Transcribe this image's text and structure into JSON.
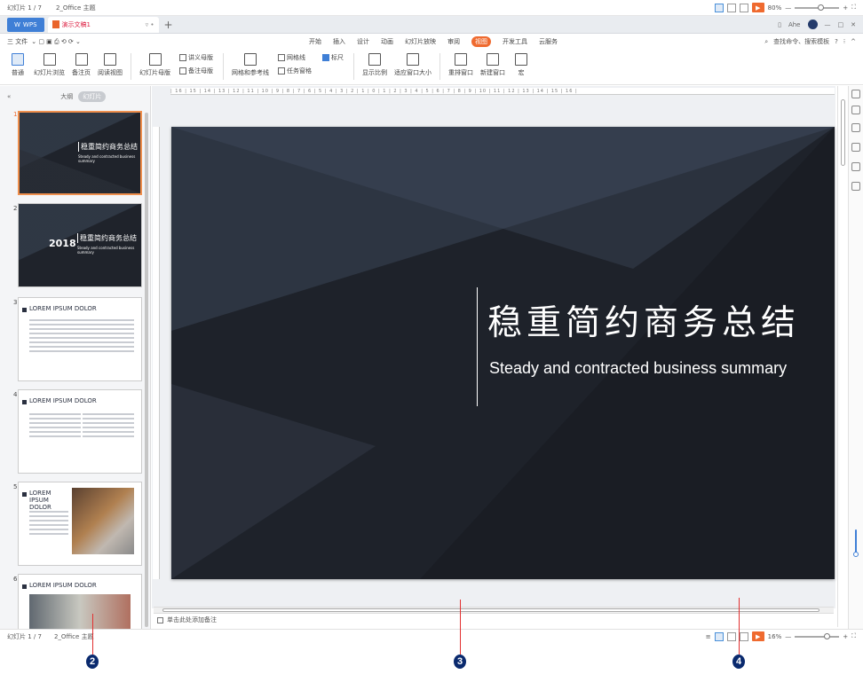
{
  "topbar": {
    "slide_counter": "幻灯片 1 / 7",
    "theme": "2_Office 主题",
    "zoom": "80%",
    "minus": "—",
    "plus": "+"
  },
  "tabs": {
    "wps_label": "WPS",
    "doc_label": "演示文稿1",
    "new_tab": "+",
    "signin": "Ahe",
    "minimize": "—",
    "restore": "□",
    "close": "✕"
  },
  "menu": {
    "file": "三 文件",
    "items": [
      "开始",
      "插入",
      "设计",
      "动画",
      "幻灯片放映",
      "审阅",
      "视图",
      "开发工具",
      "云服务"
    ],
    "active_index": 6,
    "search": "查找命令、搜索模板",
    "help": "?",
    "more": "⁝",
    "collapse": "^"
  },
  "ribbon": {
    "normal": "普通",
    "sorter": "幻灯片浏览",
    "notes_page": "备注页",
    "reading": "阅读视图",
    "slide_master": "幻灯片母版",
    "handout_master": "讲义母版",
    "notes_master": "备注母版",
    "grid": "网格和参考线",
    "gridlines": "网格线",
    "ruler": "标尺",
    "task_pane": "任务窗格",
    "zoom": "显示比例",
    "fit": "适应窗口大小",
    "arrange": "重排窗口",
    "new_window": "新建窗口",
    "macro": "宏"
  },
  "left_panel": {
    "outline": "大纲",
    "slides": "幻灯片",
    "collapse": "«"
  },
  "thumbnails": [
    {
      "num": "1",
      "title": "稳重简约商务总结",
      "sub": "Steady and contracted business summary"
    },
    {
      "num": "2",
      "year": "2018",
      "title": "稳重简约商务总结",
      "sub": "Steady and contracted business summary"
    },
    {
      "num": "3",
      "head": "LOREM IPSUM DOLOR"
    },
    {
      "num": "4",
      "head": "LOREM IPSUM DOLOR"
    },
    {
      "num": "5",
      "head": "LOREM IPSUM DOLOR"
    },
    {
      "num": "6",
      "head": "LOREM IPSUM DOLOR"
    }
  ],
  "ruler_text": "| 16 | 15 | 14 | 13 | 12 | 11 | 10 | 9 | 8 | 7 | 6 | 5 | 4 | 3 | 2 | 1 | 0 | 1 | 2 | 3 | 4 | 5 | 6 | 7 | 8 | 9 | 10 | 11 | 12 | 13 | 14 | 15 | 16 |",
  "slide": {
    "title": "稳重简约商务总结",
    "subtitle": "Steady and contracted business summary"
  },
  "notes": {
    "placeholder": "单击此处添加备注"
  },
  "status": {
    "slide_counter": "幻灯片 1 / 7",
    "theme": "2_Office 主题",
    "zoom": "16%",
    "minus": "—",
    "plus": "+"
  },
  "callouts": [
    "2",
    "3",
    "4"
  ],
  "colors": {
    "accent": "#ef6a2f",
    "slide_bg": "#1e222a",
    "wps_blue": "#3f7fd6",
    "callout_line": "#e23030",
    "callout_badge": "#0a2a6e"
  }
}
